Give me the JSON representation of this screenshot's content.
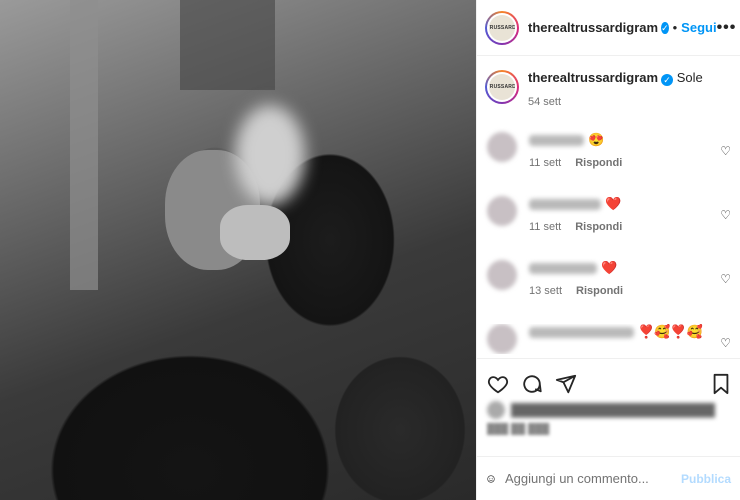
{
  "post": {
    "username": "therealtrussardigram",
    "follow_label": "Segui",
    "more_label": "•••",
    "caption_text": "Sole",
    "caption_age": "54 sett",
    "avatar_text": "TRUSSARDI"
  },
  "comments": [
    {
      "text": "😍",
      "age": "11 sett",
      "reply": "Rispondi"
    },
    {
      "text": "❤️",
      "age": "11 sett",
      "reply": "Rispondi"
    },
    {
      "text": "❤️",
      "age": "13 sett",
      "reply": "Rispondi"
    },
    {
      "text": "❣️🥰❣️🥰",
      "age": "",
      "reply": ""
    }
  ],
  "footer": {
    "comment_placeholder": "Aggiungi un commento...",
    "publish_label": "Pubblica"
  },
  "colors": {
    "accent": "#0095f6",
    "publish_disabled": "#b3dbff",
    "muted": "#737373"
  }
}
